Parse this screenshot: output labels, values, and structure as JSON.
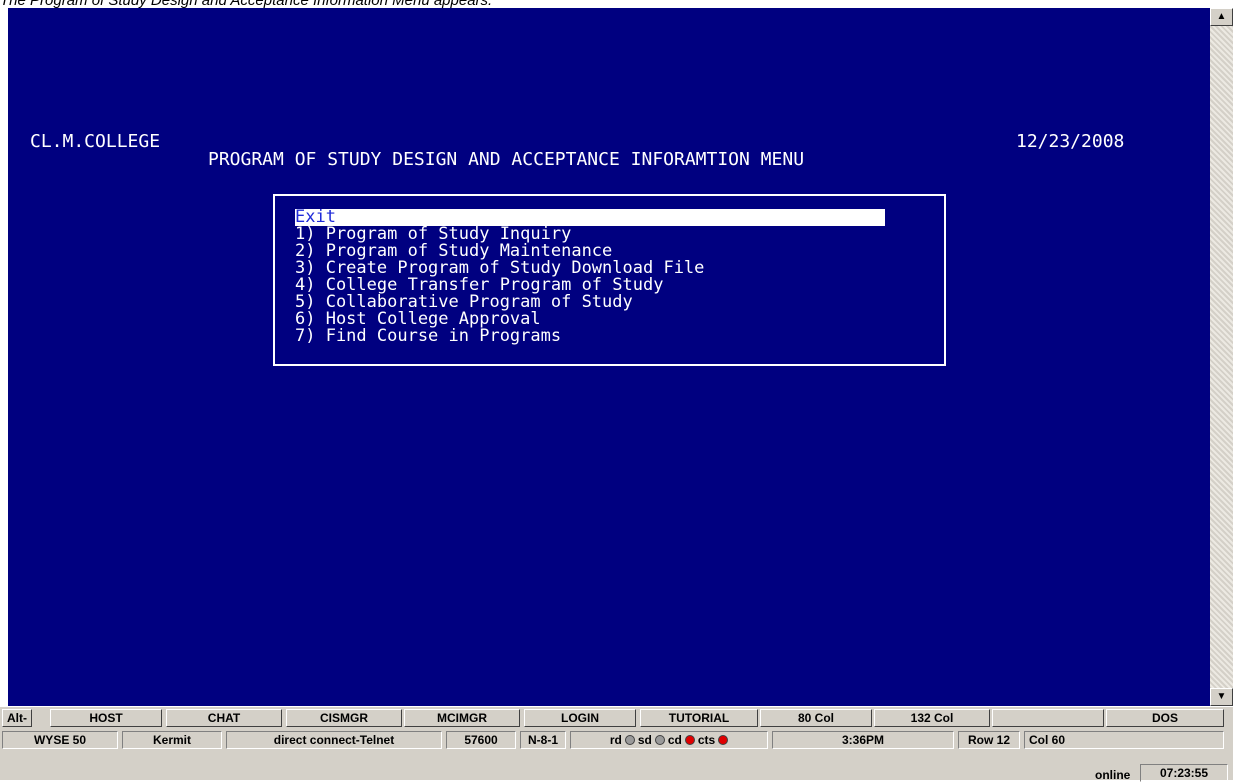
{
  "caption": "The Program of Study Design and Acceptance Information Menu appears.",
  "terminal": {
    "college": "CL.M.COLLEGE",
    "heading": "PROGRAM OF STUDY DESIGN AND ACCEPTANCE INFORAMTION MENU",
    "date": "12/23/2008",
    "menu": [
      "Exit",
      "1) Program of Study Inquiry",
      "2) Program of Study Maintenance",
      "3) Create Program of Study Download File",
      "4) College Transfer Program of Study",
      "5) Collaborative Program of Study",
      "6) Host College Approval",
      "7) Find Course in Programs"
    ],
    "colors": {
      "background": "#000080",
      "text": "#ffffff",
      "selected_text": "#1e2ad8"
    }
  },
  "function_keys": [
    "Alt-",
    "HOST",
    "CHAT",
    "CISMGR",
    "MCIMGR",
    "LOGIN",
    "TUTORIAL",
    "80 Col",
    "132 Col",
    "",
    "DOS"
  ],
  "status": {
    "terminal_type": "WYSE 50",
    "protocol": "Kermit",
    "connection": "direct connect-Telnet",
    "baud": "57600",
    "params": "N-8-1",
    "lights": [
      {
        "label": "rd",
        "state": "gray"
      },
      {
        "label": "sd",
        "state": "gray"
      },
      {
        "label": "cd",
        "state": "red"
      },
      {
        "label": "cts",
        "state": "red"
      }
    ],
    "time": "3:36PM",
    "row": "Row 12",
    "col": "Col 60"
  },
  "bottom": {
    "online": "online",
    "clock": "07:23:55"
  },
  "icons": [
    "scroll-up-arrow-icon",
    "scroll-down-arrow-icon"
  ]
}
